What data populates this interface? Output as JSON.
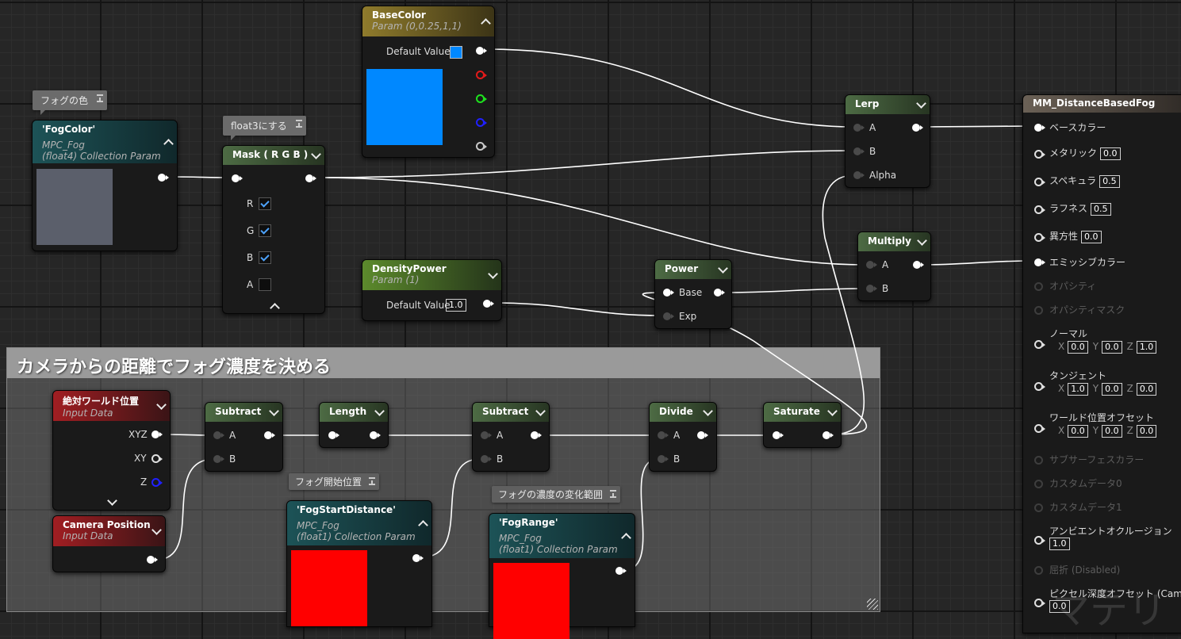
{
  "comment": {
    "title": "カメラからの距離でフォグ濃度を決める"
  },
  "bubbles": {
    "fog_color": "フォグの色",
    "float3": "float3にする",
    "fog_start": "フォグ開始位置",
    "fog_range": "フォグの濃度の変化範囲"
  },
  "nodes": {
    "base_color": {
      "title": "BaseColor",
      "subtitle": "Param (0,0.25,1,1)",
      "default_label": "Default Value",
      "color": "#0088ff"
    },
    "fog_color": {
      "title": "'FogColor'",
      "sub1": "MPC_Fog",
      "sub2": "(float4) Collection Param",
      "color": "#5b5f6b"
    },
    "mask": {
      "title": "Mask ( R G B )",
      "channels": [
        {
          "label": "R",
          "checked": true
        },
        {
          "label": "G",
          "checked": true
        },
        {
          "label": "B",
          "checked": true
        },
        {
          "label": "A",
          "checked": false
        }
      ]
    },
    "density_power": {
      "title": "DensityPower",
      "subtitle": "Param (1)",
      "default_label": "Default Value",
      "default_value": "1.0"
    },
    "power": {
      "title": "Power",
      "in1": "Base",
      "in2": "Exp"
    },
    "lerp": {
      "title": "Lerp",
      "in1": "A",
      "in2": "B",
      "in3": "Alpha"
    },
    "multiply": {
      "title": "Multiply",
      "in1": "A",
      "in2": "B"
    },
    "world_pos": {
      "title": "絶対ワールド位置",
      "subtitle": "Input Data",
      "out1": "XYZ",
      "out2": "XY",
      "out3": "Z"
    },
    "camera_pos": {
      "title": "Camera Position",
      "subtitle": "Input Data"
    },
    "subtract1": {
      "title": "Subtract",
      "in1": "A",
      "in2": "B"
    },
    "length": {
      "title": "Length"
    },
    "subtract2": {
      "title": "Subtract",
      "in1": "A",
      "in2": "B"
    },
    "divide": {
      "title": "Divide",
      "in1": "A",
      "in2": "B"
    },
    "saturate": {
      "title": "Saturate"
    },
    "fog_start": {
      "title": "'FogStartDistance'",
      "sub1": "MPC_Fog",
      "sub2": "(float1) Collection Param",
      "color": "#ff0000"
    },
    "fog_range": {
      "title": "'FogRange'",
      "sub1": "MPC_Fog",
      "sub2": "(float1) Collection Param",
      "color": "#ff0000"
    }
  },
  "material": {
    "title": "MM_DistanceBasedFog",
    "pins": {
      "base_color": "ベースカラー",
      "metallic": "メタリック",
      "metallic_val": "0.0",
      "specular": "スペキュラ",
      "specular_val": "0.5",
      "roughness": "ラフネス",
      "roughness_val": "0.5",
      "anisotropy": "異方性",
      "anisotropy_val": "0.0",
      "emissive": "エミッシブカラー",
      "opacity": "オパシティ",
      "opacity_mask": "オパシティマスク",
      "normal": "ノーマル",
      "normal_x": "0.0",
      "normal_y": "0.0",
      "normal_z": "1.0",
      "tangent": "タンジェント",
      "tangent_x": "1.0",
      "tangent_y": "0.0",
      "tangent_z": "0.0",
      "wpo": "ワールド位置オフセット",
      "wpo_x": "0.0",
      "wpo_y": "0.0",
      "wpo_z": "0.0",
      "subsurface": "サブサーフェスカラー",
      "custom0": "カスタムデータ0",
      "custom1": "カスタムデータ1",
      "ao": "アンビエントオクルージョン",
      "ao_val": "1.0",
      "refraction": "屈折 (Disabled)",
      "pdo": "ピクセル深度オフセット (Camera",
      "pdo_val": "0.0",
      "axis_x": "X",
      "axis_y": "Y",
      "axis_z": "Z"
    }
  },
  "watermark": "マテリ"
}
